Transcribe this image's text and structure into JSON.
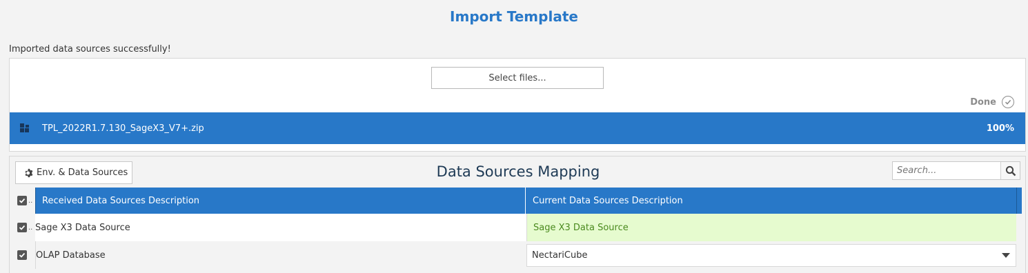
{
  "page": {
    "title": "Import Template",
    "status_message": "Imported data sources successfully!"
  },
  "upload": {
    "select_files_label": "Select files...",
    "done_label": "Done",
    "file": {
      "name": "TPL_2022R1.7.130_SageX3_V7+.zip",
      "progress_text": "100%",
      "progress": 1.0
    }
  },
  "mapping": {
    "env_button_label": "Env. & Data Sources",
    "title": "Data Sources Mapping",
    "search_placeholder": "Search...",
    "columns": {
      "checkbox_overflow": "..",
      "received": "Received Data Sources Description",
      "current": "Current Data Sources Description"
    },
    "rows": [
      {
        "checked": true,
        "overflow": "..",
        "received": "Sage X3 Data Source",
        "current": "Sage X3 Data Source"
      },
      {
        "checked": true,
        "received": "OLAP Database",
        "current": "NectariCube"
      }
    ]
  },
  "colors": {
    "accent": "#2878c8",
    "match_bg": "#e6fbcf",
    "match_text": "#4a8a1e"
  },
  "icons": [
    "file-status-icon",
    "done-check-icon",
    "gear-icon",
    "search-icon",
    "checkbox-checked-icon",
    "chevron-down-icon"
  ]
}
